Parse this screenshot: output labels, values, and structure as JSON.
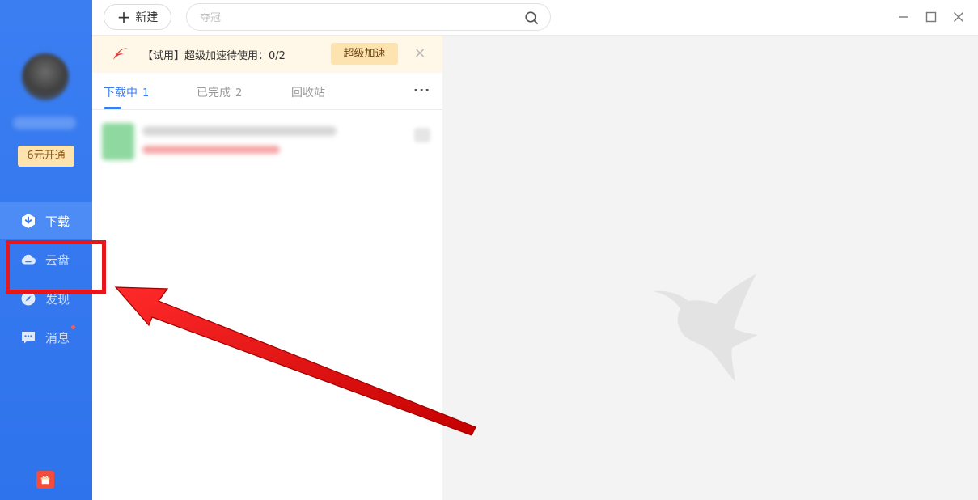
{
  "sidebar": {
    "vip_button": "6元开通",
    "items": [
      {
        "label": "下载",
        "icon": "download-shield-icon",
        "active": true
      },
      {
        "label": "云盘",
        "icon": "cloud-icon",
        "active": false
      },
      {
        "label": "发现",
        "icon": "compass-icon",
        "active": false
      },
      {
        "label": "消息",
        "icon": "message-icon",
        "active": false,
        "badge": true
      }
    ],
    "bottom_icon": "gift-icon"
  },
  "topbar": {
    "new_button": "新建",
    "search_placeholder": "夺冠",
    "window_controls": [
      "minimize-icon",
      "maximize-icon",
      "close-icon"
    ]
  },
  "promo": {
    "text": "【试用】超级加速待使用：0/2",
    "button": "超级加速",
    "close": "×"
  },
  "tabs": [
    {
      "label": "下载中",
      "count": "1",
      "active": true
    },
    {
      "label": "已完成",
      "count": "2",
      "active": false
    },
    {
      "label": "回收站",
      "count": "",
      "active": false
    }
  ],
  "more_button": "···",
  "colors": {
    "brand_blue": "#3b7ef2",
    "annotation_red": "#e5171c",
    "promo_bg": "#fff8e8"
  }
}
